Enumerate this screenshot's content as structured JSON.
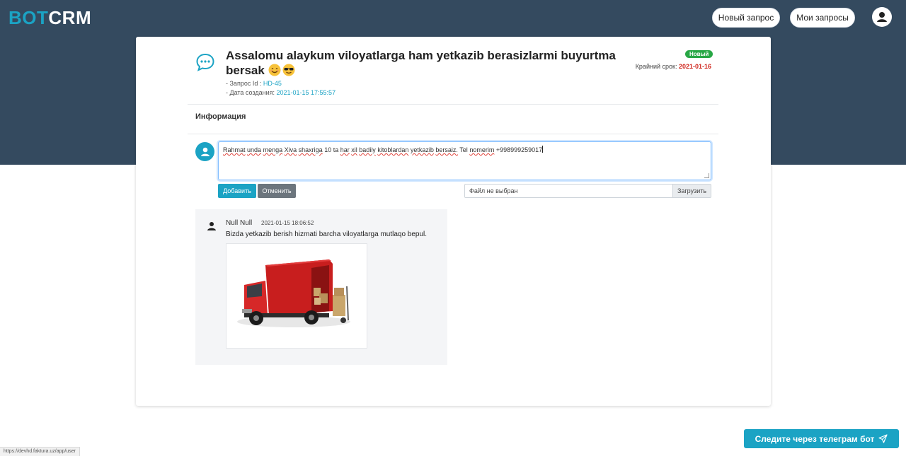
{
  "header": {
    "logo_part1": "BOT",
    "logo_part2": "CRM",
    "new_request_label": "Новый запрос",
    "my_requests_label": "Мои запросы",
    "profile_icon": "user-circle-icon"
  },
  "ticket": {
    "title": "Assalomu alaykum viloyatlarga ham yetkazib berasizlarmi buyurtma bersak",
    "title_emojis": [
      "smiling-face",
      "face-with-sunglasses"
    ],
    "request_id_label": "- Запрос Id : ",
    "request_id": "HD-45",
    "created_label": "- Дата создания: ",
    "created_date": "2021-01-15 17:55:57",
    "status_badge": "Новый",
    "deadline_label": "Крайний срок: ",
    "deadline_date": "2021-01-16",
    "colors": {
      "status": "#28a745",
      "deadline": "#d0281f",
      "accent": "#1ba3c4"
    }
  },
  "info": {
    "section_title": "Информация"
  },
  "reply": {
    "text_words": [
      "Rahmat",
      "unda",
      "menga",
      "Xiva",
      "shaxriga",
      "10 ta",
      "har",
      "xil",
      "badiiy",
      "kitoblardan",
      "yetkazib",
      "bersaiz.",
      "Tel",
      "nomerim",
      "+998999259017"
    ],
    "add_label": "Добавить",
    "cancel_label": "Отменить",
    "file_placeholder": "Файл не выбран",
    "upload_label": "Загрузить"
  },
  "comment": {
    "author": "Null Null",
    "time": "2021-01-15 18:06:52",
    "text": "Bizda yetkazib berish hizmati barcha viloyatlarga mutlaqo bepul.",
    "attachment": "red-delivery-truck-image"
  },
  "footer": {
    "telegram_label": "Следите через телеграм бот",
    "status_url": "https://devhd.faktura.uz/app/user"
  }
}
